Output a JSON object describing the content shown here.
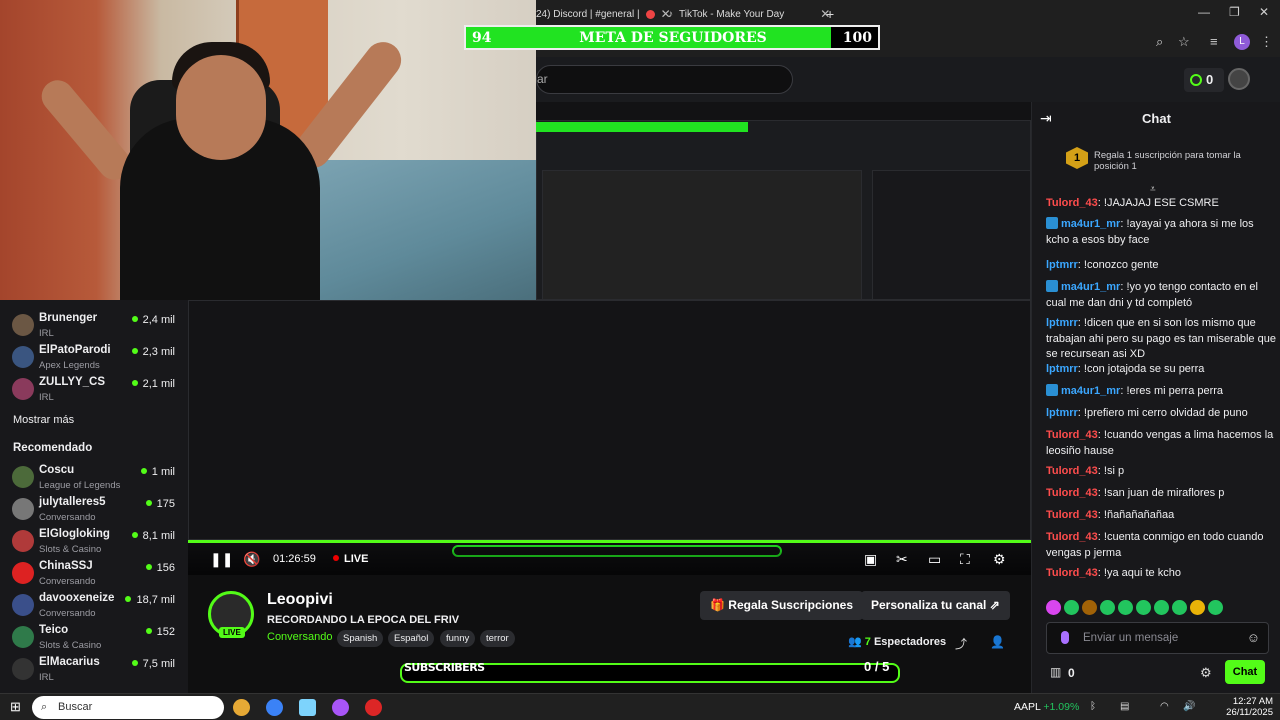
{
  "browser": {
    "tabs": [
      {
        "label": "24) Discord | #general |"
      },
      {
        "label": "TikTok - Make Your Day"
      }
    ],
    "new_tab": "+",
    "window_controls": {
      "minimize": "—",
      "restore": "❐",
      "close": "✕"
    },
    "profile_initial": "L"
  },
  "topbar": {
    "search_placeholder": "ar",
    "kicks_count": "0"
  },
  "overlay_goal": {
    "start": "94",
    "title": "META DE SEGUIDORES",
    "end": "100",
    "progress": 0.94
  },
  "sidebar": {
    "channels_top": [
      {
        "name": "Brunenger",
        "category": "IRL",
        "viewers": "2,4 mil"
      },
      {
        "name": "ElPatoParodi",
        "category": "Apex Legends",
        "viewers": "2,3 mil"
      },
      {
        "name": "ZULLYY_CS",
        "category": "IRL",
        "viewers": "2,1 mil"
      }
    ],
    "show_more": "Mostrar más",
    "recommended_heading": "Recomendado",
    "recommended": [
      {
        "name": "Coscu",
        "category": "League of Legends",
        "viewers": "1 mil"
      },
      {
        "name": "julytalleres5",
        "category": "Conversando",
        "viewers": "175"
      },
      {
        "name": "ElGlogloking",
        "category": "Slots & Casino",
        "viewers": "8,1 mil"
      },
      {
        "name": "ChinaSSJ",
        "category": "Conversando",
        "viewers": "156"
      },
      {
        "name": "davooxeneize",
        "category": "Conversando",
        "viewers": "18,7 mil"
      },
      {
        "name": "Teico",
        "category": "Slots & Casino",
        "viewers": "152"
      },
      {
        "name": "ElMacarius",
        "category": "IRL",
        "viewers": "7,5 mil"
      }
    ]
  },
  "player": {
    "time": "01:26:59",
    "live": "LIVE"
  },
  "channel": {
    "username": "Leoopivi",
    "live_badge": "LIVE",
    "stream_title": "RECORDANDO LA EPOCA DEL FRIV",
    "category": "Conversando",
    "tags": [
      "Spanish",
      "Español",
      "funny",
      "terror"
    ],
    "gift_button": "Regala Suscripciones",
    "customize_button": "Personaliza tu canal",
    "viewers_count": "7",
    "viewers_label": "Espectadores"
  },
  "sub_goal": {
    "label": "SUBSCRIBERS",
    "count": "0 / 5",
    "progress": 0
  },
  "chat": {
    "title": "Chat",
    "pinned_rank": "1",
    "pinned_text": "Regala 1 suscripción para tomar la posición 1",
    "messages": [
      {
        "user": "Tulord_43",
        "color": "#ff4d4d",
        "badge": false,
        "text": "!JAJAJAJ ESE CSMRE"
      },
      {
        "user": "ma4ur1_mr",
        "color": "#3ba7ff",
        "badge": true,
        "text": "!ayayai ya ahora si me los kcho a esos bby face"
      },
      {
        "user": "lptmrr",
        "color": "#3ba7ff",
        "badge": false,
        "text": "!conozco gente"
      },
      {
        "user": "ma4ur1_mr",
        "color": "#3ba7ff",
        "badge": true,
        "text": "!yo yo tengo contacto en el cual me dan dni y td completó"
      },
      {
        "user": "lptmrr",
        "color": "#3ba7ff",
        "badge": false,
        "text": "!dicen que en si son los mismo que trabajan ahi pero su pago es tan miserable que se recursean asi XD"
      },
      {
        "user": "lptmrr",
        "color": "#3ba7ff",
        "badge": false,
        "text": "!con jotajoda se su perra"
      },
      {
        "user": "ma4ur1_mr",
        "color": "#3ba7ff",
        "badge": true,
        "text": "!eres mi perra perra"
      },
      {
        "user": "lptmrr",
        "color": "#3ba7ff",
        "badge": false,
        "text": "!prefiero mi cerro olvidad de puno"
      },
      {
        "user": "Tulord_43",
        "color": "#ff4d4d",
        "badge": false,
        "text": "!cuando vengas a lima hacemos la leosiño hause"
      },
      {
        "user": "Tulord_43",
        "color": "#ff4d4d",
        "badge": false,
        "text": "!si p"
      },
      {
        "user": "Tulord_43",
        "color": "#ff4d4d",
        "badge": false,
        "text": "!san juan de miraflores p"
      },
      {
        "user": "Tulord_43",
        "color": "#ff4d4d",
        "badge": false,
        "text": "!ñañañañañaa"
      },
      {
        "user": "Tulord_43",
        "color": "#ff4d4d",
        "badge": false,
        "text": "!cuenta conmigo en todo cuando vengas p jerma"
      },
      {
        "user": "Tulord_43",
        "color": "#ff4d4d",
        "badge": false,
        "text": "!ya aqui te kcho"
      }
    ],
    "input_placeholder": "Enviar un mensaje",
    "points": "0",
    "send_button": "Chat"
  },
  "taskbar": {
    "search": "Buscar",
    "stock_name": "AAPL",
    "stock_change": "+1.09%",
    "time": "12:27 AM",
    "date": "26/11/2025"
  },
  "colors": {
    "accent": "#53fc18",
    "goal_fill": "#21e321",
    "chat_red": "#ff4d4d",
    "chat_blue": "#3ba7ff"
  }
}
